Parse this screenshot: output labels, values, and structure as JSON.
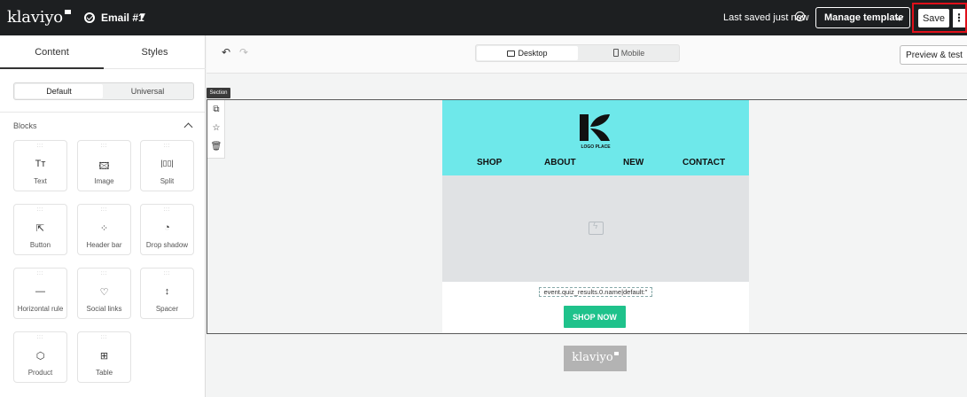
{
  "app": {
    "logo": "klaviyo"
  },
  "header": {
    "email_name": "Email #1",
    "last_saved": "Last saved just now",
    "manage_template": "Manage template",
    "save": "Save"
  },
  "left_panel": {
    "tabs": [
      "Content",
      "Styles"
    ],
    "segments": [
      "Default",
      "Universal"
    ],
    "blocks_title": "Blocks",
    "blocks": [
      {
        "label": "Text",
        "icon": "text-icon",
        "glyph": "Tт"
      },
      {
        "label": "Image",
        "icon": "image-icon",
        "glyph": "🖾"
      },
      {
        "label": "Split",
        "icon": "split-icon",
        "glyph": "|▯▯|"
      },
      {
        "label": "Button",
        "icon": "button-icon",
        "glyph": "⇱"
      },
      {
        "label": "Header bar",
        "icon": "header-bar-icon",
        "glyph": "⁘"
      },
      {
        "label": "Drop shadow",
        "icon": "drop-shadow-icon",
        "glyph": "◔"
      },
      {
        "label": "Horizontal rule",
        "icon": "horizontal-rule-icon",
        "glyph": "—"
      },
      {
        "label": "Social links",
        "icon": "heart-icon",
        "glyph": "♡"
      },
      {
        "label": "Spacer",
        "icon": "spacer-icon",
        "glyph": "↕"
      },
      {
        "label": "Product",
        "icon": "product-icon",
        "glyph": "⬡"
      },
      {
        "label": "Table",
        "icon": "table-icon",
        "glyph": "⊞"
      }
    ]
  },
  "toolbar": {
    "desktop": "Desktop",
    "mobile": "Mobile",
    "preview": "Preview & test"
  },
  "canvas": {
    "section_tag": "Section",
    "logo_text": "LOGO PLACE",
    "nav": [
      "SHOP",
      "ABOUT",
      "NEW",
      "CONTACT"
    ],
    "dynamic_text": "event.quiz_results.0.name|default:''",
    "cta": "SHOP NOW",
    "footer_logo": "klaviyo",
    "colors": {
      "header_bg": "#6ee8ea",
      "cta_bg": "#1fc28b",
      "topbar_bg": "#1d1f21",
      "highlight": "#e0101a"
    }
  }
}
